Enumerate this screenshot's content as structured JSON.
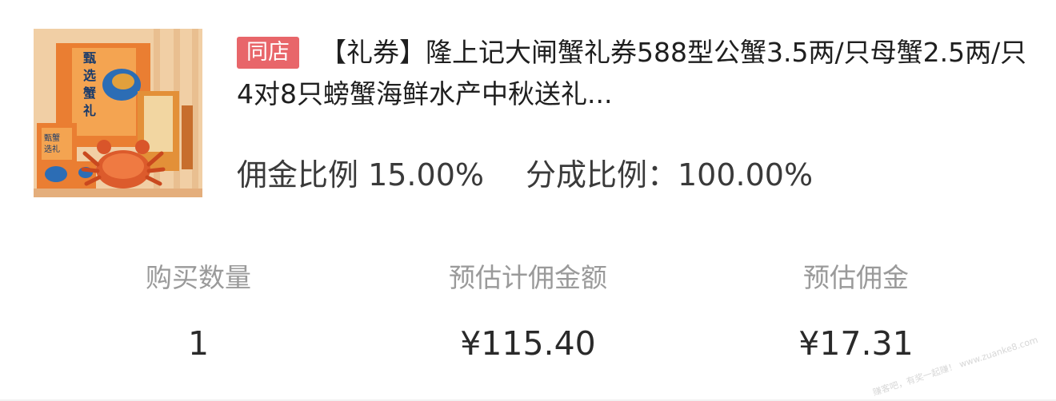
{
  "product": {
    "image_icon": "crab-gift-box-image",
    "badge": "同店",
    "badge_color": "#e8666a",
    "title": "【礼券】隆上记大闸蟹礼券588型公蟹3.5两/只母蟹2.5两/只4对8只螃蟹海鲜水产中秋送礼..."
  },
  "rates": {
    "commission_rate": "佣金比例 15.00%",
    "share_rate": "分成比例：100.00%"
  },
  "stats": {
    "quantity_label": "购买数量",
    "quantity_value": "1",
    "estimated_amount_label": "预估计佣金额",
    "estimated_amount_value": "¥115.40",
    "estimated_commission_label": "预估佣金",
    "estimated_commission_value": "¥17.31"
  },
  "watermark": "赚客吧，有奖一起赚！ www.zuanke8.com"
}
